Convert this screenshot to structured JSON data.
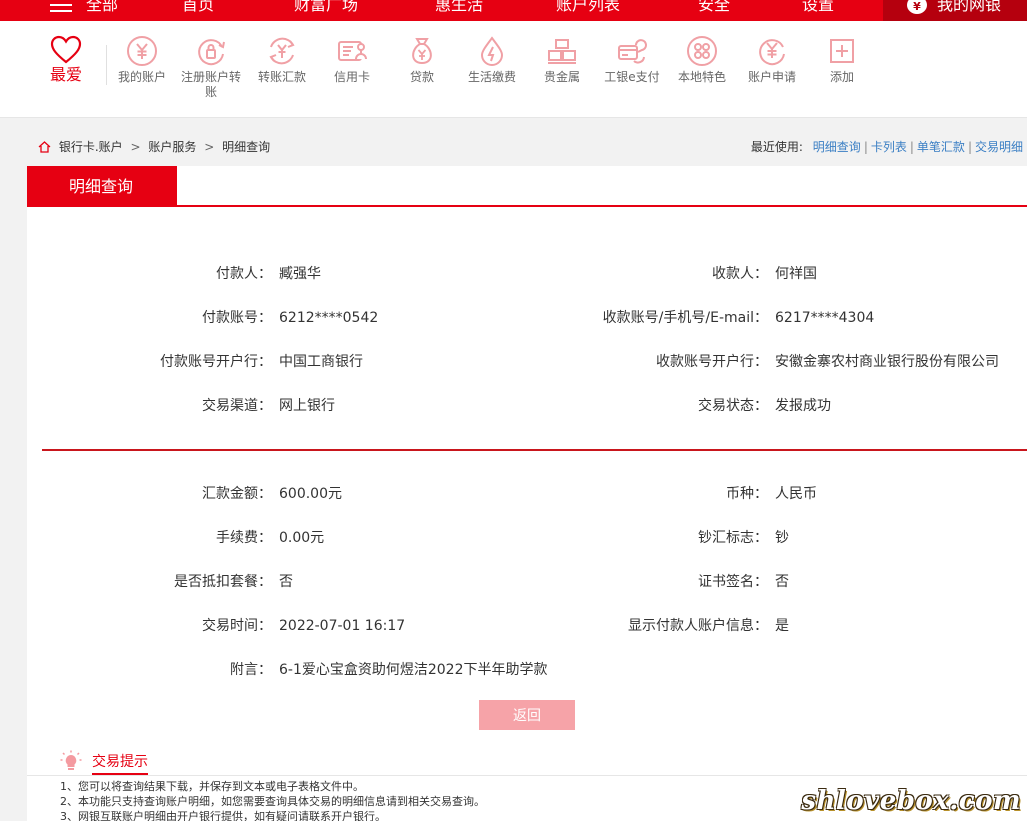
{
  "topnav": {
    "items": [
      "全部",
      "首页",
      "财富广场",
      "惠生活",
      "账户列表",
      "安全",
      "设置"
    ],
    "mybank": "我的网银"
  },
  "shortcuts": {
    "favorite": "最爱",
    "items": [
      {
        "label": "我的账户",
        "icon": "yen-coin-icon"
      },
      {
        "label": "注册账户转账",
        "icon": "lock-transfer-icon"
      },
      {
        "label": "转账汇款",
        "icon": "exchange-icon"
      },
      {
        "label": "信用卡",
        "icon": "credit-card-icon"
      },
      {
        "label": "贷款",
        "icon": "money-bag-icon"
      },
      {
        "label": "生活缴费",
        "icon": "water-drop-icon"
      },
      {
        "label": "贵金属",
        "icon": "gold-bars-icon"
      },
      {
        "label": "工银e支付",
        "icon": "e-pay-icon"
      },
      {
        "label": "本地特色",
        "icon": "local-icon"
      },
      {
        "label": "账户申请",
        "icon": "account-apply-icon"
      },
      {
        "label": "添加",
        "icon": "add-icon"
      }
    ]
  },
  "breadcrumb": {
    "items": [
      "银行卡.账户",
      "账户服务",
      "明细查询"
    ],
    "separator": ">"
  },
  "recent": {
    "label": "最近使用:",
    "links": [
      "明细查询",
      "卡列表",
      "单笔汇款",
      "交易明细"
    ]
  },
  "tab": {
    "title": "明细查询"
  },
  "details": {
    "rows_top": [
      {
        "l_label": "付款人：",
        "l_value": "臧强华",
        "r_label": "收款人：",
        "r_value": "何祥国"
      },
      {
        "l_label": "付款账号：",
        "l_value": "6212****0542",
        "r_label": "收款账号/手机号/E-mail：",
        "r_value": "6217****4304"
      },
      {
        "l_label": "付款账号开户行：",
        "l_value": "中国工商银行",
        "r_label": "收款账号开户行：",
        "r_value": "安徽金寨农村商业银行股份有限公司"
      },
      {
        "l_label": "交易渠道：",
        "l_value": "网上银行",
        "r_label": "交易状态：",
        "r_value": "发报成功"
      }
    ],
    "rows_bottom": [
      {
        "l_label": "汇款金额：",
        "l_value": "600.00元",
        "r_label": "币种：",
        "r_value": "人民币"
      },
      {
        "l_label": "手续费：",
        "l_value": "0.00元",
        "r_label": "钞汇标志：",
        "r_value": "钞"
      },
      {
        "l_label": "是否抵扣套餐：",
        "l_value": "否",
        "r_label": "证书签名：",
        "r_value": "否"
      },
      {
        "l_label": "交易时间：",
        "l_value": "2022-07-01 16:17",
        "r_label": "显示付款人账户信息：",
        "r_value": "是"
      }
    ],
    "memo_label": "附言：",
    "memo_value": "6-1爱心宝盒资助何煜洁2022下半年助学款",
    "return_button": "返回"
  },
  "tips": {
    "title": "交易提示",
    "items": [
      "1、您可以将查询结果下载，并保存到文本或电子表格文件中。",
      "2、本功能只支持查询账户明细，如您需要查询具体交易的明细信息请到相关交易查询。",
      "3、网银互联账户明细由开户银行提供，如有疑问请联系开户银行。"
    ]
  },
  "watermark": "shlovebox.com",
  "colors": {
    "brand_red": "#e60012",
    "link_blue": "#3b7fc4",
    "button_disabled": "#f6a3a8"
  }
}
